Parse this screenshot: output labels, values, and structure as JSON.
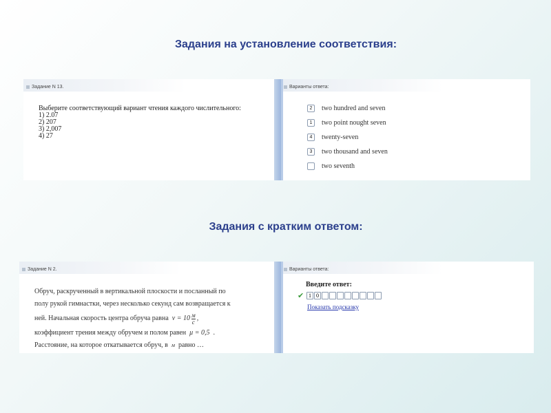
{
  "headings": {
    "matching": "Задания на установление соответствия:",
    "short_answer": "Задания с кратким ответом:"
  },
  "task1": {
    "header": "Задание N 13.",
    "question": "Выберите соответствующий вариант чтения каждого числительного:",
    "items": [
      "1) 2.07",
      "2) 207",
      "3) 2,007",
      "4) 27"
    ],
    "answers_header": "Варианты ответа:",
    "options": [
      {
        "mark": "2",
        "label": "two hundred and seven"
      },
      {
        "mark": "1",
        "label": "two point nought seven"
      },
      {
        "mark": "4",
        "label": "twenty-seven"
      },
      {
        "mark": "3",
        "label": "two thousand and seven"
      },
      {
        "mark": "",
        "label": "two seventh"
      }
    ]
  },
  "task2": {
    "header": "Задание N 2.",
    "lines": [
      "Обруч, раскрученный в вертикальной плоскости и посланный по",
      "полу рукой гимнастки, через несколько секунд сам возвращается к",
      "ней. Начальная скорость центра обруча равна",
      "коэффициент трения между обручем и полом равен",
      "Расстояние, на которое откатывается обруч, в",
      "равно …"
    ],
    "formula_v": "v = 10",
    "formula_num": "м",
    "formula_den": "с",
    "formula_mu": "μ = 0,5",
    "unit_m": "м",
    "answers_header": "Варианты ответа:",
    "prompt": "Введите ответ:",
    "answer_cells": [
      "1",
      "0",
      "",
      "",
      "",
      "",
      "",
      "",
      "",
      ""
    ],
    "hint_link": "Показать подсказку"
  },
  "colors": {
    "heading": "#2b3f8c",
    "check": "#3a9a3a",
    "link": "#2233aa"
  }
}
